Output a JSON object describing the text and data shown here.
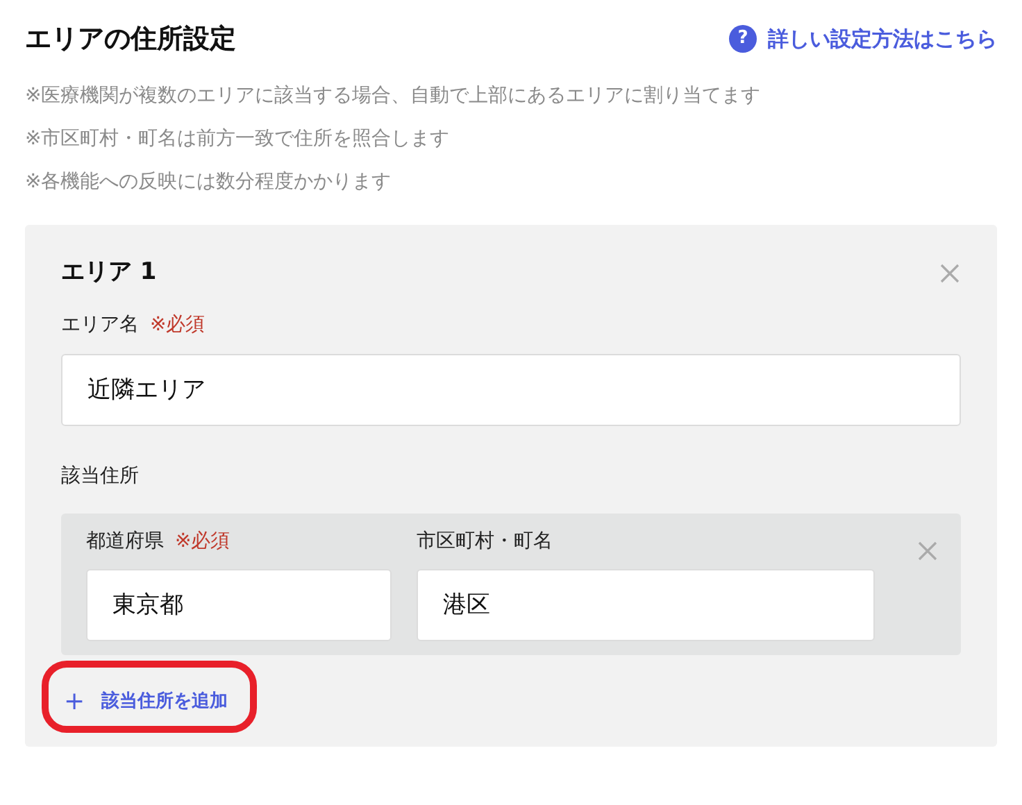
{
  "title": "エリアの住所設定",
  "help_link": {
    "icon": "?",
    "label": "詳しい設定方法はこちら"
  },
  "notes": [
    "※医療機関が複数のエリアに該当する場合、自動で上部にあるエリアに割り当てます",
    "※市区町村・町名は前方一致で住所を照合します",
    "※各機能への反映には数分程度かかります"
  ],
  "areas": [
    {
      "title": "エリア 1",
      "name_field": {
        "label": "エリア名",
        "required": "※必須",
        "value": "近隣エリア"
      },
      "addresses_label": "該当住所",
      "addresses": [
        {
          "prefecture": {
            "label": "都道府県",
            "required": "※必須",
            "value": "東京都"
          },
          "city": {
            "label": "市区町村・町名",
            "value": "港区"
          }
        }
      ],
      "add_address": {
        "icon": "+",
        "label": "該当住所を追加",
        "highlighted": true
      }
    }
  ]
}
